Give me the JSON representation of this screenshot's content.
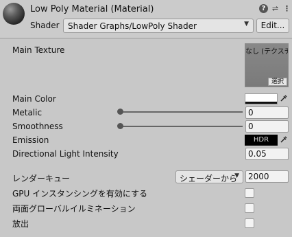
{
  "header": {
    "title": "Low Poly Material (Material)",
    "shader_label": "Shader",
    "shader_value": "Shader Graphs/LowPoly Shader",
    "edit_label": "Edit...",
    "help_icon": "?",
    "preset_icon": "⇌",
    "menu_icon": "⋮"
  },
  "properties": {
    "main_texture": {
      "label": "Main Texture",
      "none_text": "なし (テクスチャ)",
      "select_label": "選択"
    },
    "main_color": {
      "label": "Main Color",
      "color": "#ffffff"
    },
    "metallic": {
      "label": "Metalic",
      "value": "0"
    },
    "smoothness": {
      "label": "Smoothness",
      "value": "0"
    },
    "emission": {
      "label": "Emission",
      "hdr_label": "HDR",
      "color": "#000000"
    },
    "directional_light": {
      "label": "Directional Light Intensity",
      "value": "0.05"
    }
  },
  "advanced": {
    "render_queue": {
      "label": "レンダーキュー",
      "dropdown_value": "シェーダーから",
      "value": "2000"
    },
    "gpu_instancing": {
      "label": "GPU インスタンシングを有効にする",
      "checked": false
    },
    "double_sided_gi": {
      "label": "両面グローバルイルミネーション",
      "checked": false
    },
    "emission_flag": {
      "label": "放出",
      "checked": false
    }
  },
  "icons": {
    "picker": "eyedropper-icon",
    "arrow": "▼"
  }
}
